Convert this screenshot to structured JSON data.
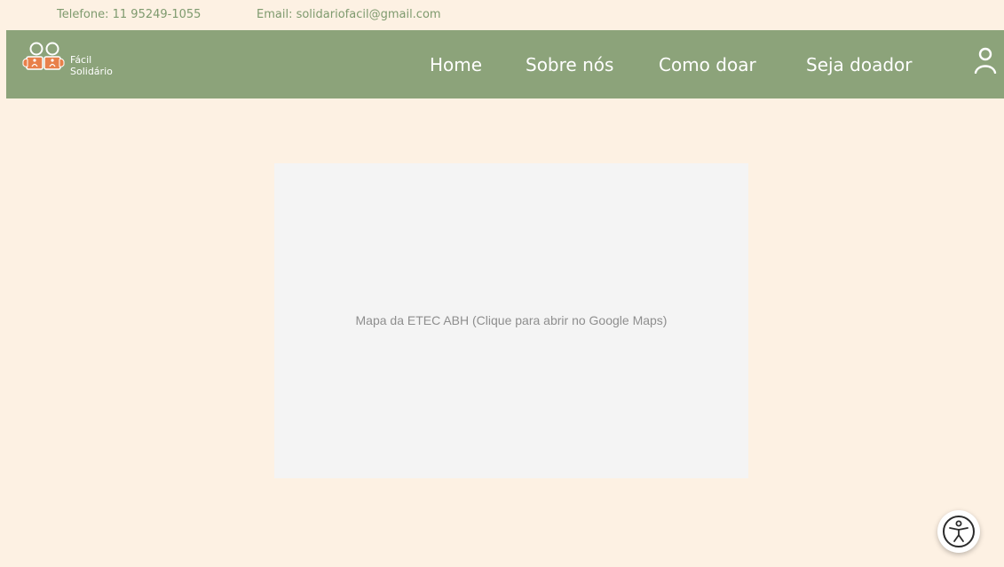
{
  "topbar": {
    "phone": "Telefone: 11 95249-1055",
    "email": "Email: solidariofacil@gmail.com"
  },
  "header": {
    "logo_line1": "Fácil",
    "logo_line2": "Solidário",
    "nav": [
      "Home",
      "Sobre nós",
      "Como doar",
      "Seja doador"
    ],
    "user_icon": "user-icon"
  },
  "main": {
    "map_caption": "Mapa da ETEC ABH (Clique para abrir no Google Maps)"
  },
  "accessibility": {
    "icon": "accessibility-icon"
  },
  "colors": {
    "background": "#fdf1e3",
    "navbar": "#8ca37a",
    "topbar_text": "#7e9a6e",
    "logo_orange": "#e8804a",
    "map_placeholder": "#f4f4f4"
  }
}
